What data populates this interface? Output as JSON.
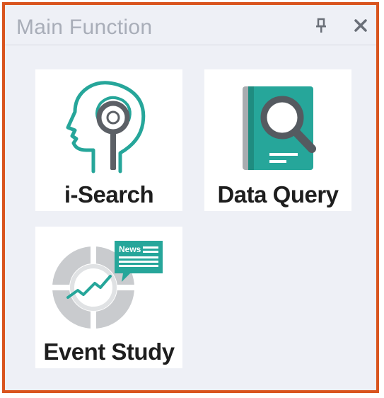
{
  "panel": {
    "title": "Main Function",
    "buttons": [
      {
        "name": "pin",
        "icon": "pin-icon"
      },
      {
        "name": "close",
        "icon": "close-icon"
      }
    ]
  },
  "functions": [
    {
      "label": "i-Search",
      "icon": "head-magnifier-icon"
    },
    {
      "label": "Data Query",
      "icon": "book-magnifier-icon"
    },
    {
      "label": "Event Study",
      "icon": "news-chart-icon",
      "icon_text": "News"
    }
  ],
  "colors": {
    "border": "#d9541e",
    "panel_bg": "#eef0f6",
    "title": "#a8adb8",
    "teal": "#26a69a",
    "dark_gray": "#555a60",
    "light_gray": "#c9cbce"
  }
}
